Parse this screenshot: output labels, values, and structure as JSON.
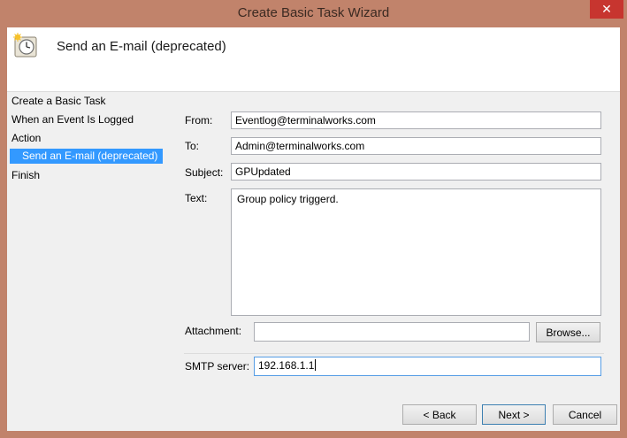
{
  "window": {
    "title": "Create Basic Task Wizard",
    "close_glyph": "✕"
  },
  "header": {
    "title": "Send an E-mail (deprecated)",
    "icon": "clock-task-icon"
  },
  "sidebar": {
    "items": [
      {
        "label": "Create a Basic Task"
      },
      {
        "label": "When an Event Is Logged"
      },
      {
        "label": "Action"
      },
      {
        "label": "Send an E-mail (deprecated)",
        "selected": true
      },
      {
        "label": "Finish"
      }
    ]
  },
  "form": {
    "from_label": "From:",
    "from_value": "Eventlog@terminalworks.com",
    "to_label": "To:",
    "to_value": "Admin@terminalworks.com",
    "subject_label": "Subject:",
    "subject_value": "GPUpdated",
    "text_label": "Text:",
    "text_value": "Group policy triggerd.",
    "attachment_label": "Attachment:",
    "attachment_value": "",
    "browse_label": "Browse...",
    "smtp_label": "SMTP server:",
    "smtp_value": "192.168.1.1"
  },
  "footer": {
    "back_label": "< Back",
    "next_label": "Next >",
    "cancel_label": "Cancel"
  },
  "colors": {
    "frame": "#c1836b",
    "selection": "#3399ff",
    "close": "#c7352f"
  }
}
